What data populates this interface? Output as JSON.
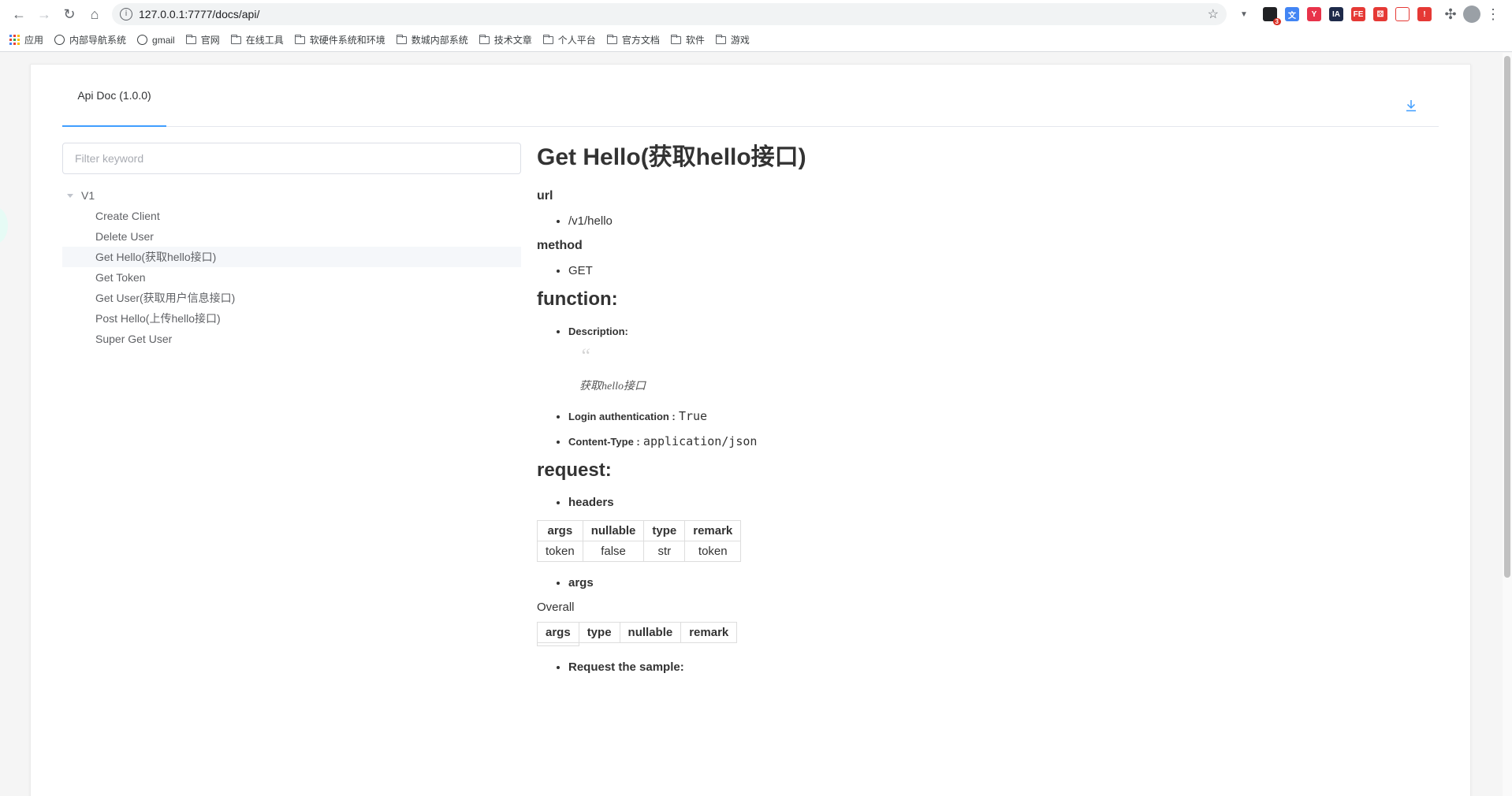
{
  "browser": {
    "url": "127.0.0.1:7777/docs/api/",
    "extensions": [
      {
        "name": "ext-1",
        "color": "#202124",
        "text": "",
        "badge": "3"
      },
      {
        "name": "translate",
        "color": "#4285f4",
        "text": "文",
        "badge": ""
      },
      {
        "name": "ext-red-round",
        "color": "#e8334a",
        "text": "Y",
        "badge": ""
      },
      {
        "name": "intellij",
        "color": "#1e2a4a",
        "text": "IA",
        "badge": ""
      },
      {
        "name": "fe-helper",
        "color": "#e53935",
        "text": "FE",
        "badge": ""
      },
      {
        "name": "ext-dice",
        "color": "#e53935",
        "text": "⚄",
        "badge": ""
      },
      {
        "name": "ext-key",
        "color": "#ffffff",
        "text": "",
        "badge": ""
      },
      {
        "name": "ext-shield",
        "color": "#e53935",
        "text": "!",
        "badge": ""
      }
    ]
  },
  "bookmarks": [
    {
      "label": "应用",
      "icon": "apps-icon"
    },
    {
      "label": "内部导航系统",
      "icon": "globe-icon"
    },
    {
      "label": "gmail",
      "icon": "globe-icon"
    },
    {
      "label": "官网",
      "icon": "folder-icon"
    },
    {
      "label": "在线工具",
      "icon": "folder-icon"
    },
    {
      "label": "软硬件系统和环境",
      "icon": "folder-icon"
    },
    {
      "label": "数城内部系统",
      "icon": "folder-icon"
    },
    {
      "label": "技术文章",
      "icon": "folder-icon"
    },
    {
      "label": "个人平台",
      "icon": "folder-icon"
    },
    {
      "label": "官方文档",
      "icon": "folder-icon"
    },
    {
      "label": "软件",
      "icon": "folder-icon"
    },
    {
      "label": "游戏",
      "icon": "folder-icon"
    }
  ],
  "tabs": {
    "active": "Api Doc (1.0.0)"
  },
  "sidebar": {
    "filter_placeholder": "Filter keyword",
    "root": "V1",
    "items": [
      "Create Client",
      "Delete User",
      "Get Hello(获取hello接口)",
      "Get Token",
      "Get User(获取用户信息接口)",
      "Post Hello(上传hello接口)",
      "Super Get User"
    ],
    "active_index": 2
  },
  "doc": {
    "title": "Get Hello(获取hello接口)",
    "url_label": "url",
    "url_value": "/v1/hello",
    "method_label": "method",
    "method_value": "GET",
    "function_label": "function:",
    "description_label": "Description:",
    "quote_mark": "“",
    "description_value": "获取hello接口",
    "login_label": "Login authentication :",
    "login_value": "True",
    "content_type_label": "Content-Type :",
    "content_type_value": "application/json",
    "request_label": "request:",
    "headers_label": "headers",
    "headers_table": {
      "columns": [
        "args",
        "nullable",
        "type",
        "remark"
      ],
      "rows": [
        [
          "token",
          "false",
          "str",
          "token"
        ]
      ]
    },
    "args_label": "args",
    "overall_label": "Overall",
    "args_table": {
      "columns": [
        "args",
        "type",
        "nullable",
        "remark"
      ],
      "rows": []
    },
    "sample_label": "Request the sample:"
  }
}
